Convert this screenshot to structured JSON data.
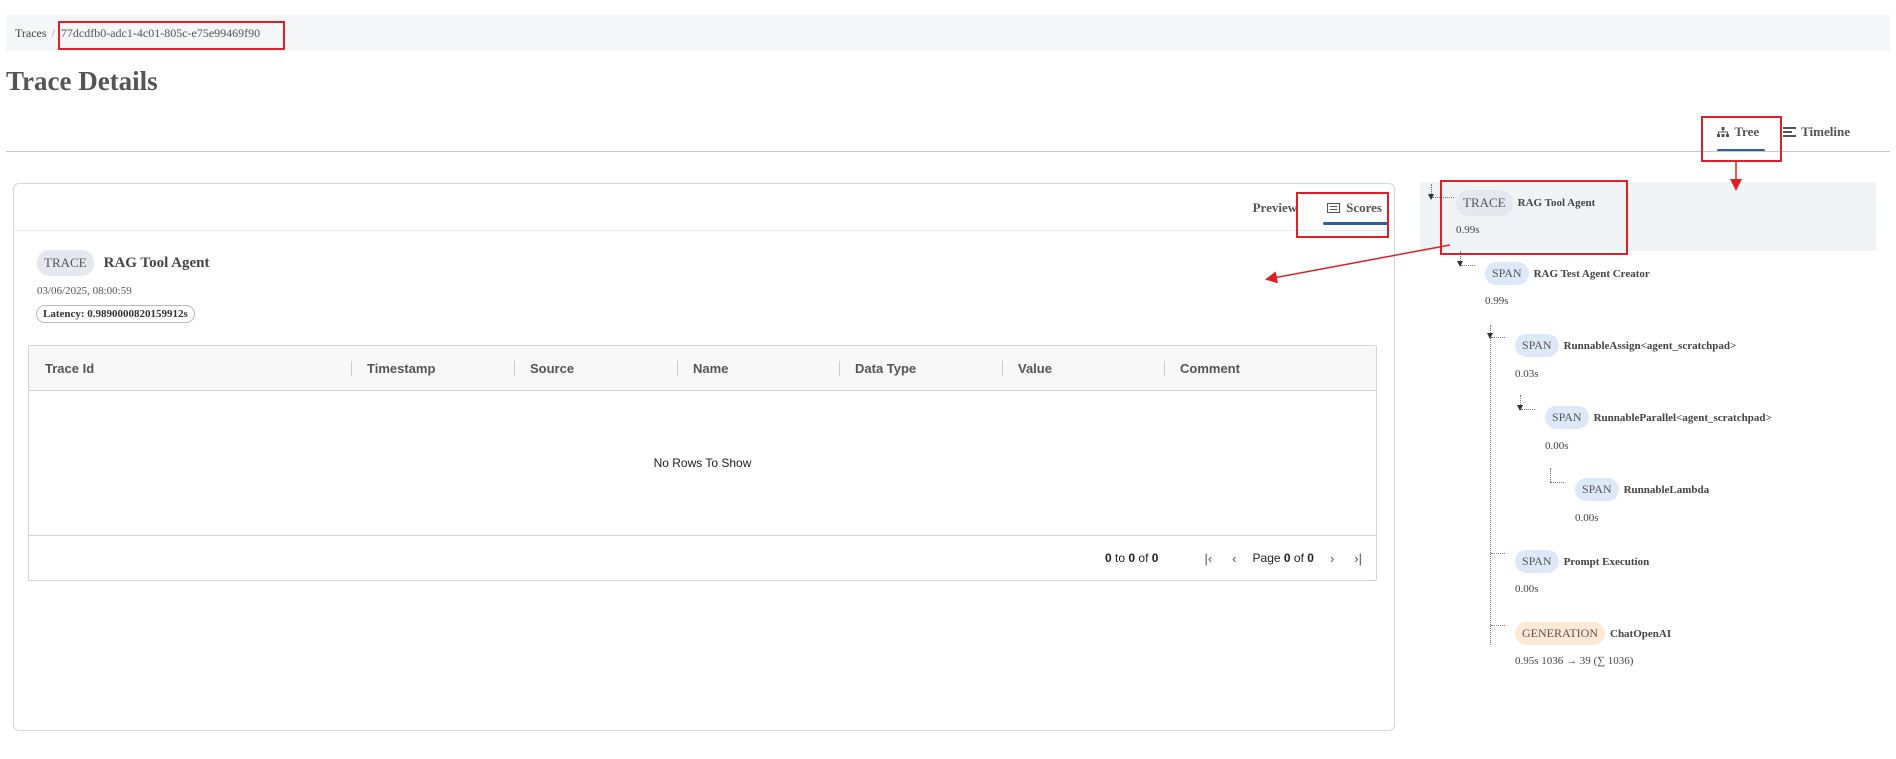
{
  "breadcrumb": {
    "root": "Traces",
    "current": "77dcdfb0-adc1-4c01-805c-e75e99469f90"
  },
  "page": {
    "title": "Trace Details"
  },
  "view_toggle": {
    "tree": "Tree",
    "timeline": "Timeline",
    "active": "Tree"
  },
  "panel": {
    "tabs": {
      "preview": "Preview",
      "scores": "Scores",
      "active": "Scores"
    },
    "trace": {
      "type": "TRACE",
      "name": "RAG Tool Agent",
      "date": "03/06/2025, 08:00:59",
      "latency": "Latency: 0.9890000820159912s"
    },
    "grid": {
      "columns": [
        "Trace Id",
        "Timestamp",
        "Source",
        "Name",
        "Data Type",
        "Value",
        "Comment"
      ],
      "empty_text": "No Rows To Show",
      "range_from": "0",
      "range_to": "0",
      "range_total": "0",
      "page_current": "0",
      "page_total": "0"
    }
  },
  "tree": {
    "nodes": [
      {
        "type": "TRACE",
        "name": "RAG Tool Agent",
        "time": "0.99s"
      },
      {
        "type": "SPAN",
        "name": "RAG Test Agent Creator",
        "time": "0.99s"
      },
      {
        "type": "SPAN",
        "name": "RunnableAssign<agent_scratchpad>",
        "time": "0.03s"
      },
      {
        "type": "SPAN",
        "name": "RunnableParallel<agent_scratchpad>",
        "time": "0.00s"
      },
      {
        "type": "SPAN",
        "name": "RunnableLambda",
        "time": "0.00s"
      },
      {
        "type": "SPAN",
        "name": "Prompt Execution",
        "time": "0.00s"
      },
      {
        "type": "GENERATION",
        "name": "ChatOpenAI",
        "time": "0.95s 1036 → 39 (∑ 1036)"
      }
    ]
  },
  "colors": {
    "accent": "#2b5ea7",
    "annotation": "#e01f26",
    "span_badge": "#dde8f8",
    "generation_badge": "#fde9d4"
  }
}
